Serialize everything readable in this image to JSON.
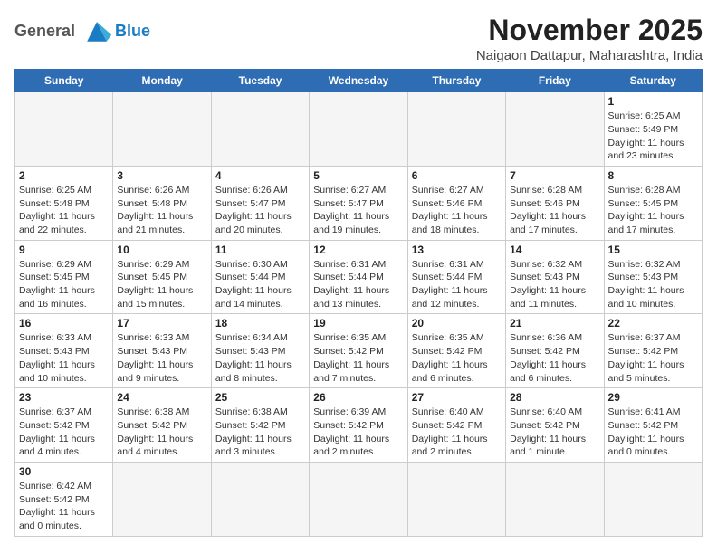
{
  "header": {
    "logo_general": "General",
    "logo_blue": "Blue",
    "main_title": "November 2025",
    "sub_title": "Naigaon Dattapur, Maharashtra, India"
  },
  "weekdays": [
    "Sunday",
    "Monday",
    "Tuesday",
    "Wednesday",
    "Thursday",
    "Friday",
    "Saturday"
  ],
  "weeks": [
    [
      {
        "day": "",
        "info": ""
      },
      {
        "day": "",
        "info": ""
      },
      {
        "day": "",
        "info": ""
      },
      {
        "day": "",
        "info": ""
      },
      {
        "day": "",
        "info": ""
      },
      {
        "day": "",
        "info": ""
      },
      {
        "day": "1",
        "info": "Sunrise: 6:25 AM\nSunset: 5:49 PM\nDaylight: 11 hours\nand 23 minutes."
      }
    ],
    [
      {
        "day": "2",
        "info": "Sunrise: 6:25 AM\nSunset: 5:48 PM\nDaylight: 11 hours\nand 22 minutes."
      },
      {
        "day": "3",
        "info": "Sunrise: 6:26 AM\nSunset: 5:48 PM\nDaylight: 11 hours\nand 21 minutes."
      },
      {
        "day": "4",
        "info": "Sunrise: 6:26 AM\nSunset: 5:47 PM\nDaylight: 11 hours\nand 20 minutes."
      },
      {
        "day": "5",
        "info": "Sunrise: 6:27 AM\nSunset: 5:47 PM\nDaylight: 11 hours\nand 19 minutes."
      },
      {
        "day": "6",
        "info": "Sunrise: 6:27 AM\nSunset: 5:46 PM\nDaylight: 11 hours\nand 18 minutes."
      },
      {
        "day": "7",
        "info": "Sunrise: 6:28 AM\nSunset: 5:46 PM\nDaylight: 11 hours\nand 17 minutes."
      },
      {
        "day": "8",
        "info": "Sunrise: 6:28 AM\nSunset: 5:45 PM\nDaylight: 11 hours\nand 17 minutes."
      }
    ],
    [
      {
        "day": "9",
        "info": "Sunrise: 6:29 AM\nSunset: 5:45 PM\nDaylight: 11 hours\nand 16 minutes."
      },
      {
        "day": "10",
        "info": "Sunrise: 6:29 AM\nSunset: 5:45 PM\nDaylight: 11 hours\nand 15 minutes."
      },
      {
        "day": "11",
        "info": "Sunrise: 6:30 AM\nSunset: 5:44 PM\nDaylight: 11 hours\nand 14 minutes."
      },
      {
        "day": "12",
        "info": "Sunrise: 6:31 AM\nSunset: 5:44 PM\nDaylight: 11 hours\nand 13 minutes."
      },
      {
        "day": "13",
        "info": "Sunrise: 6:31 AM\nSunset: 5:44 PM\nDaylight: 11 hours\nand 12 minutes."
      },
      {
        "day": "14",
        "info": "Sunrise: 6:32 AM\nSunset: 5:43 PM\nDaylight: 11 hours\nand 11 minutes."
      },
      {
        "day": "15",
        "info": "Sunrise: 6:32 AM\nSunset: 5:43 PM\nDaylight: 11 hours\nand 10 minutes."
      }
    ],
    [
      {
        "day": "16",
        "info": "Sunrise: 6:33 AM\nSunset: 5:43 PM\nDaylight: 11 hours\nand 10 minutes."
      },
      {
        "day": "17",
        "info": "Sunrise: 6:33 AM\nSunset: 5:43 PM\nDaylight: 11 hours\nand 9 minutes."
      },
      {
        "day": "18",
        "info": "Sunrise: 6:34 AM\nSunset: 5:43 PM\nDaylight: 11 hours\nand 8 minutes."
      },
      {
        "day": "19",
        "info": "Sunrise: 6:35 AM\nSunset: 5:42 PM\nDaylight: 11 hours\nand 7 minutes."
      },
      {
        "day": "20",
        "info": "Sunrise: 6:35 AM\nSunset: 5:42 PM\nDaylight: 11 hours\nand 6 minutes."
      },
      {
        "day": "21",
        "info": "Sunrise: 6:36 AM\nSunset: 5:42 PM\nDaylight: 11 hours\nand 6 minutes."
      },
      {
        "day": "22",
        "info": "Sunrise: 6:37 AM\nSunset: 5:42 PM\nDaylight: 11 hours\nand 5 minutes."
      }
    ],
    [
      {
        "day": "23",
        "info": "Sunrise: 6:37 AM\nSunset: 5:42 PM\nDaylight: 11 hours\nand 4 minutes."
      },
      {
        "day": "24",
        "info": "Sunrise: 6:38 AM\nSunset: 5:42 PM\nDaylight: 11 hours\nand 4 minutes."
      },
      {
        "day": "25",
        "info": "Sunrise: 6:38 AM\nSunset: 5:42 PM\nDaylight: 11 hours\nand 3 minutes."
      },
      {
        "day": "26",
        "info": "Sunrise: 6:39 AM\nSunset: 5:42 PM\nDaylight: 11 hours\nand 2 minutes."
      },
      {
        "day": "27",
        "info": "Sunrise: 6:40 AM\nSunset: 5:42 PM\nDaylight: 11 hours\nand 2 minutes."
      },
      {
        "day": "28",
        "info": "Sunrise: 6:40 AM\nSunset: 5:42 PM\nDaylight: 11 hours\nand 1 minute."
      },
      {
        "day": "29",
        "info": "Sunrise: 6:41 AM\nSunset: 5:42 PM\nDaylight: 11 hours\nand 0 minutes."
      }
    ],
    [
      {
        "day": "30",
        "info": "Sunrise: 6:42 AM\nSunset: 5:42 PM\nDaylight: 11 hours\nand 0 minutes."
      },
      {
        "day": "",
        "info": ""
      },
      {
        "day": "",
        "info": ""
      },
      {
        "day": "",
        "info": ""
      },
      {
        "day": "",
        "info": ""
      },
      {
        "day": "",
        "info": ""
      },
      {
        "day": "",
        "info": ""
      }
    ]
  ]
}
